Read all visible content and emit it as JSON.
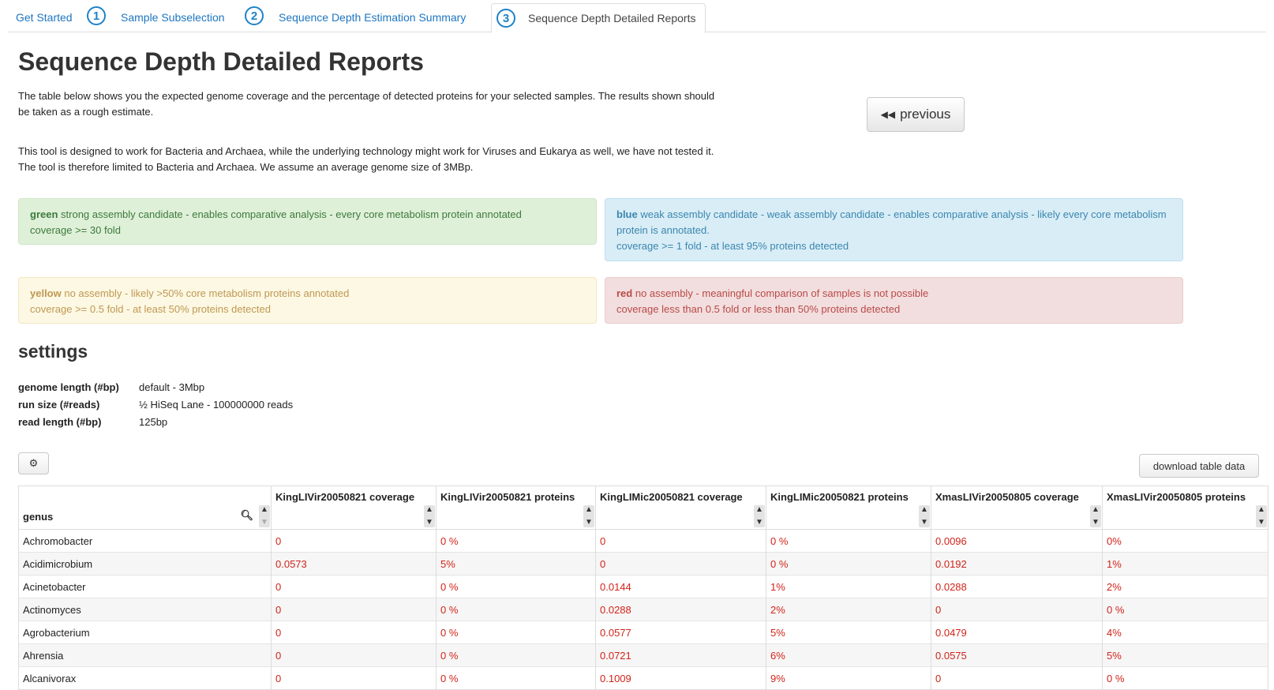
{
  "tabs": [
    {
      "label": "Get Started"
    },
    {
      "number": "1",
      "label": "Sample Subselection"
    },
    {
      "number": "2",
      "label": "Sequence Depth Estimation Summary"
    },
    {
      "number": "3",
      "label": "Sequence Depth Detailed Reports"
    }
  ],
  "title": "Sequence Depth Detailed Reports",
  "intro": {
    "p1": "The table below shows you the expected genome coverage and the percentage of detected proteins for your selected samples. The results shown should be taken as a rough estimate.",
    "p2": "This tool is designed to work for Bacteria and Archaea, while the underlying technology might work for Viruses and Eukarya as well, we have not tested it. The tool is therefore limited to Bacteria and Archaea. We assume an average genome size of 3MBp."
  },
  "previous_button": {
    "icon": "double-chevron-left-icon",
    "label": "previous"
  },
  "legend": {
    "green": {
      "keyword": "green",
      "line1": " strong assembly candidate - enables comparative analysis - every core metabolism protein annotated",
      "line2": "coverage >= 30 fold"
    },
    "blue": {
      "keyword": "blue",
      "line1": " weak assembly candidate - weak assembly candidate - enables comparative analysis - likely every core metabolism protein is annotated.",
      "line2": "coverage >= 1 fold - at least 95% proteins detected"
    },
    "yellow": {
      "keyword": "yellow",
      "line1": " no assembly - likely >50% core metabolism proteins annotated",
      "line2": "coverage >= 0.5 fold - at least 50% proteins detected"
    },
    "red": {
      "keyword": "red",
      "line1": " no assembly - meaningful comparison of samples is not possible",
      "line2": "coverage less than 0.5 fold or less than 50% proteins detected"
    }
  },
  "settings": {
    "title": "settings",
    "rows": [
      {
        "key": "genome length (#bp)",
        "value": "default - 3Mbp"
      },
      {
        "key": "run size (#reads)",
        "value": "½ HiSeq Lane - 100000000 reads"
      },
      {
        "key": "read length (#bp)",
        "value": "125bp"
      }
    ]
  },
  "gear_button": {
    "icon": "gear-icon"
  },
  "download_button": {
    "label": "download table data"
  },
  "table": {
    "headers": [
      "genus",
      "KingLIVir20050821 coverage",
      "KingLIVir20050821 proteins",
      "KingLIMic20050821 coverage",
      "KingLIMic20050821 proteins",
      "XmasLIVir20050805 coverage",
      "XmasLIVir20050805 proteins"
    ],
    "rows": [
      [
        "Achromobacter",
        "0",
        "0 %",
        "0",
        "0 %",
        "0.0096",
        "0%"
      ],
      [
        "Acidimicrobium",
        "0.0573",
        "5%",
        "0",
        "0 %",
        "0.0192",
        "1%"
      ],
      [
        "Acinetobacter",
        "0",
        "0 %",
        "0.0144",
        "1%",
        "0.0288",
        "2%"
      ],
      [
        "Actinomyces",
        "0",
        "0 %",
        "0.0288",
        "2%",
        "0",
        "0 %"
      ],
      [
        "Agrobacterium",
        "0",
        "0 %",
        "0.0577",
        "5%",
        "0.0479",
        "4%"
      ],
      [
        "Ahrensia",
        "0",
        "0 %",
        "0.0721",
        "6%",
        "0.0575",
        "5%"
      ],
      [
        "Alcanivorax",
        "0",
        "0 %",
        "0.1009",
        "9%",
        "0",
        "0 %"
      ]
    ],
    "value_color": "#d1241a"
  },
  "colors": {
    "accent": "#1e76c0",
    "green": "#3c7a3c",
    "blue": "#3a87ad",
    "yellow": "#c09853",
    "red": "#b94a48"
  }
}
